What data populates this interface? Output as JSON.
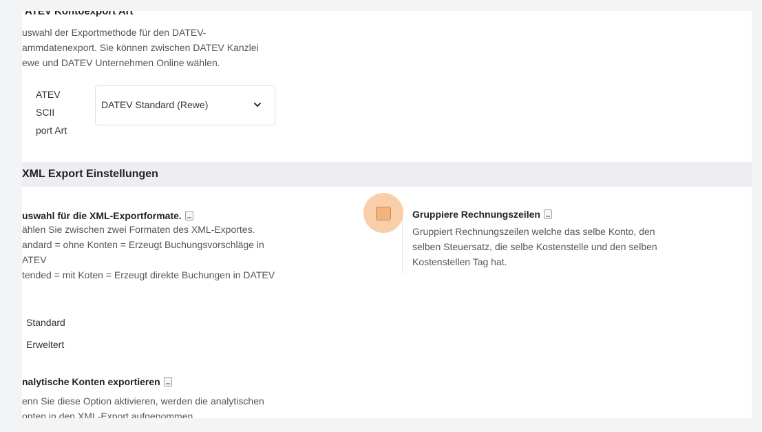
{
  "datev_section": {
    "title": "ATEV Kontoexport Art",
    "description_lines": [
      "uswahl der Exportmethode für den DATEV-",
      "ammdatenexport. Sie können zwischen DATEV Kanzlei",
      "ewe und DATEV Unternehmen Online wählen."
    ],
    "field_label_lines": [
      "ATEV",
      "SCII",
      "port Art"
    ],
    "select_value": "DATEV Standard (Rewe)"
  },
  "xml_section": {
    "header": "XML Export Einstellungen",
    "format_title": "uswahl für die XML-Exportformate.",
    "format_desc_lines": [
      "ählen Sie zwischen zwei Formaten des XML-Exportes.",
      "andard = ohne Konten = Erzeugt Buchungsvorschläge in",
      "ATEV",
      "tended = mit Koten = Erzeugt direkte Buchungen in DATEV"
    ],
    "radio_options": [
      "Standard",
      "Erweitert"
    ],
    "analytic_title": "nalytische Konten exportieren",
    "analytic_desc_lines": [
      "enn Sie diese Option aktivieren, werden die analytischen",
      "onten in den XML-Export aufgenommen"
    ],
    "group_title": "Gruppiere Rechnungszeilen",
    "group_desc_lines": [
      "Gruppiert Rechnungszeilen welche das selbe Konto, den",
      "selben Steuersatz, die selbe Kostenstelle und den selben",
      "Kostenstellen Tag hat."
    ]
  },
  "colors": {
    "highlight": "#f5bf8e",
    "band": "#eceef1"
  }
}
